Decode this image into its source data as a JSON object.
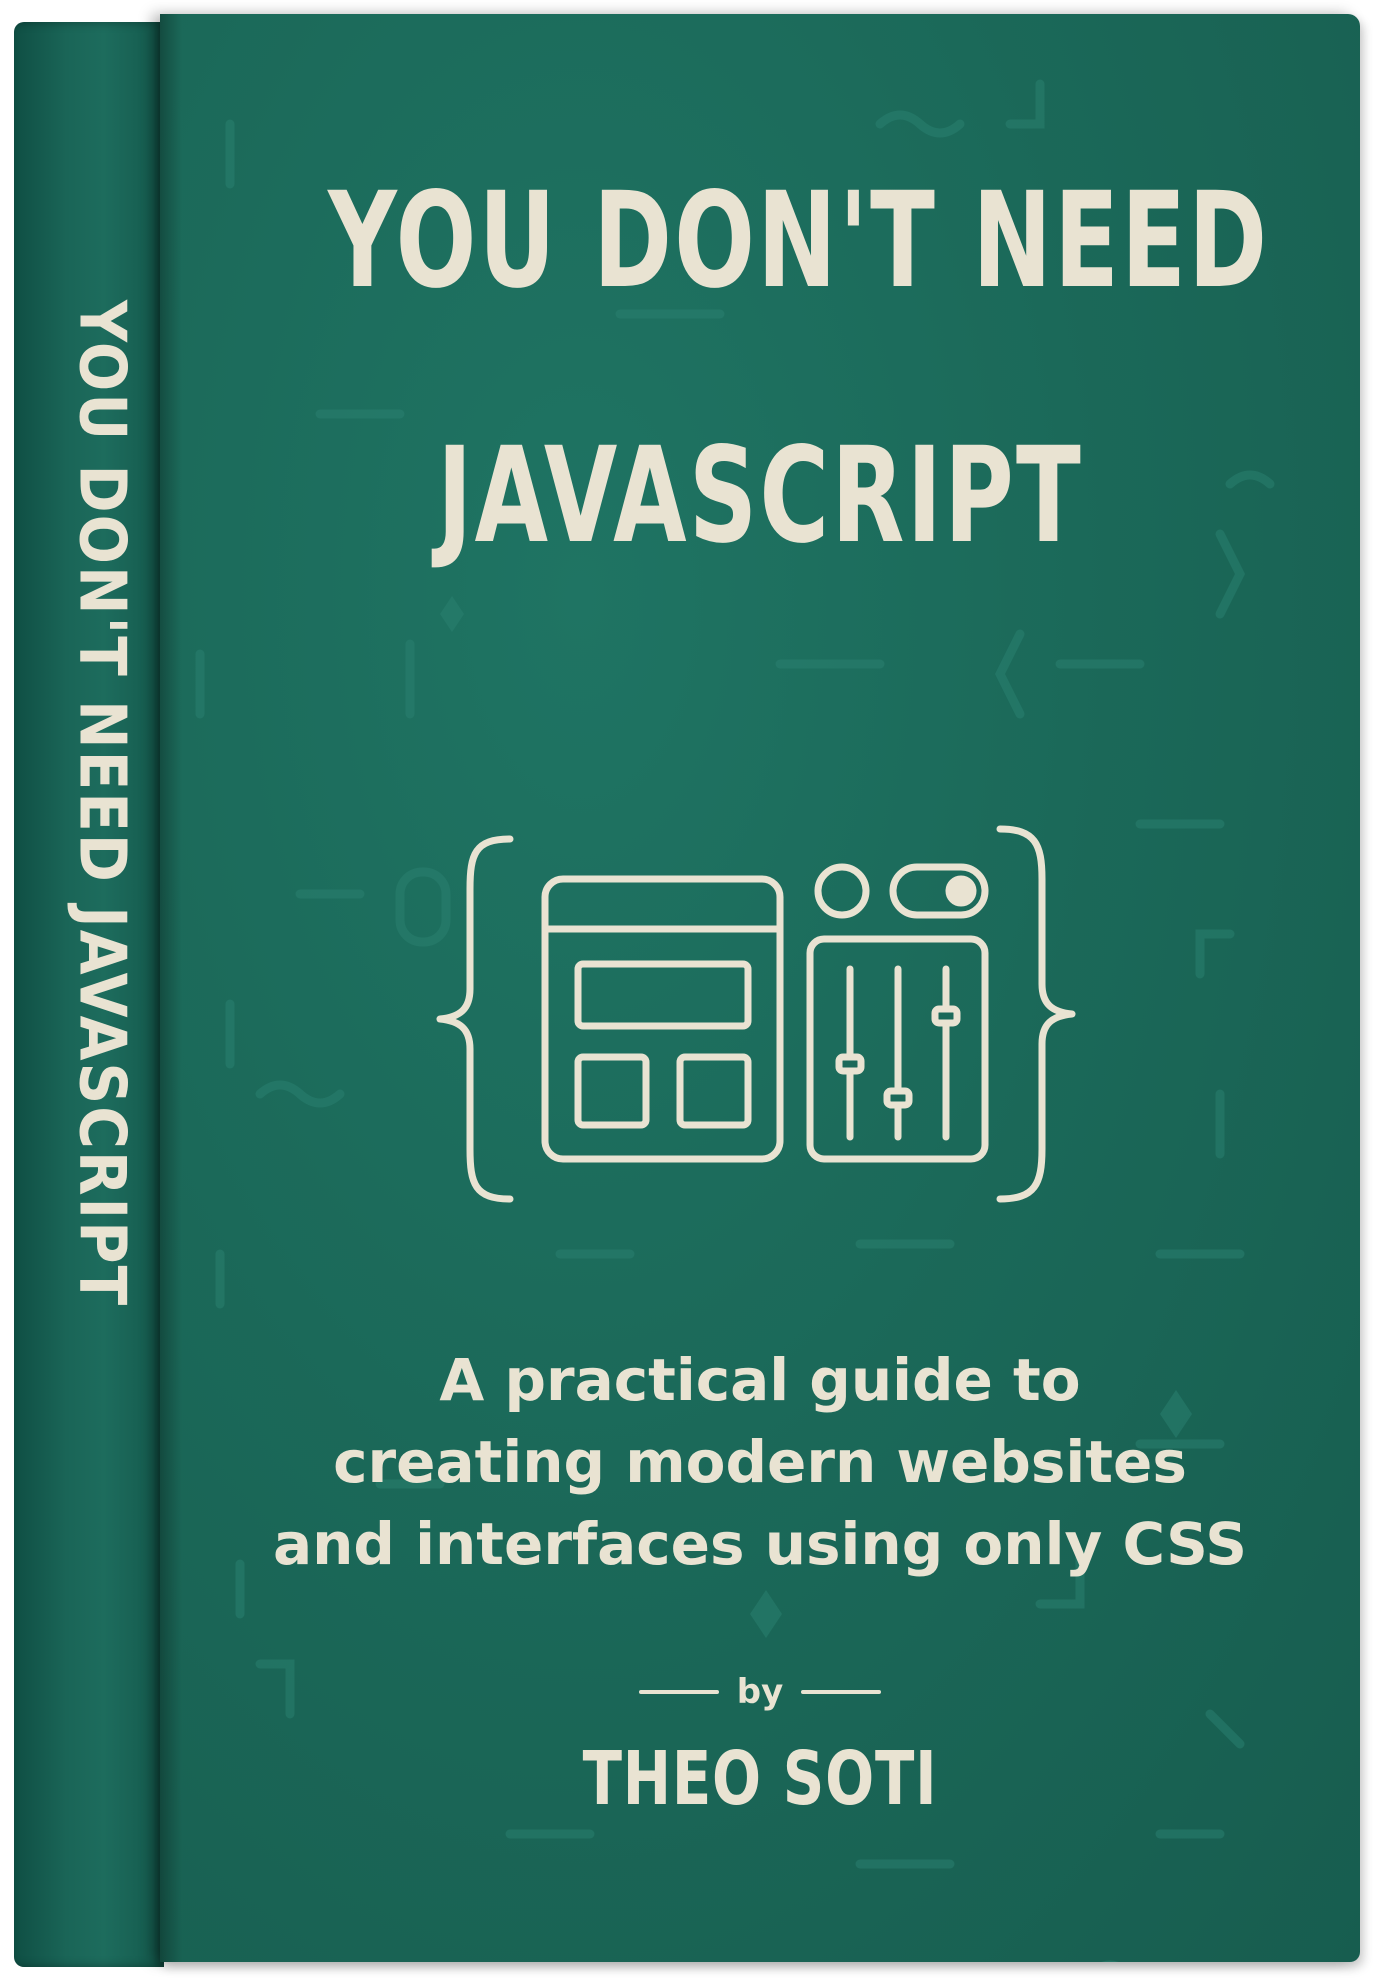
{
  "book": {
    "spine_title": "YOU DON'T NEED JAVASCRIPT",
    "title_line_1": "YOU DON'T NEED",
    "title_line_2": "JAVASCRIPT",
    "subtitle_lines": [
      "A practical guide to",
      "creating modern websites",
      "and interfaces using only CSS"
    ],
    "by_label": "by",
    "author": "THEO SOTI"
  },
  "colors": {
    "cover": "#1b6959",
    "spine": "#14594c",
    "ink": "#e9e3d2"
  },
  "icons": [
    "curly-braces-icon",
    "browser-window-icon",
    "sliders-panel-icon",
    "toggle-switch-icon",
    "radio-circle-icon"
  ]
}
